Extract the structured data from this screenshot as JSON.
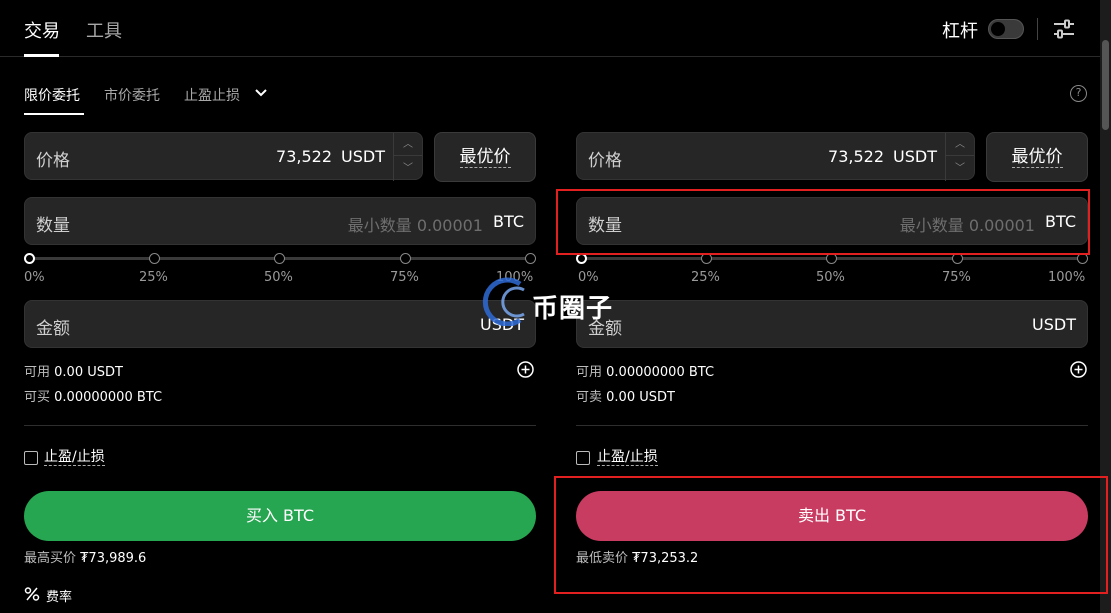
{
  "header": {
    "tabs": [
      {
        "label": "交易",
        "active": true
      },
      {
        "label": "工具",
        "active": false
      }
    ],
    "leverage_label": "杠杆",
    "leverage_enabled": false
  },
  "order_types": {
    "tabs": [
      "限价委托",
      "市价委托",
      "止盈止损"
    ],
    "active_index": 0
  },
  "buy": {
    "price_label": "价格",
    "price_value": "73,522",
    "price_unit": "USDT",
    "best_price_label": "最优价",
    "quantity_label": "数量",
    "quantity_placeholder": "最小数量 0.00001",
    "quantity_unit": "BTC",
    "slider_marks": [
      "0%",
      "25%",
      "50%",
      "75%",
      "100%"
    ],
    "amount_label": "金额",
    "amount_unit": "USDT",
    "available_label": "可用",
    "available_value": "0.00 USDT",
    "can_trade_label": "可买",
    "can_trade_value": "0.00000000 BTC",
    "tpsl_label": "止盈/止损",
    "button_label": "买入 BTC",
    "note_label": "最高买价",
    "note_value": "₮73,989.6",
    "accent_color": "#27a651"
  },
  "sell": {
    "price_label": "价格",
    "price_value": "73,522",
    "price_unit": "USDT",
    "best_price_label": "最优价",
    "quantity_label": "数量",
    "quantity_placeholder": "最小数量 0.00001",
    "quantity_unit": "BTC",
    "slider_marks": [
      "0%",
      "25%",
      "50%",
      "75%",
      "100%"
    ],
    "amount_label": "金额",
    "amount_unit": "USDT",
    "available_label": "可用",
    "available_value": "0.00000000 BTC",
    "can_trade_label": "可卖",
    "can_trade_value": "0.00 USDT",
    "tpsl_label": "止盈/止损",
    "button_label": "卖出 BTC",
    "note_label": "最低卖价",
    "note_value": "₮73,253.2",
    "accent_color": "#c93c62"
  },
  "fee_label": "费率",
  "watermark_text": "币圈子",
  "icons": [
    "settings-icon",
    "chevron-down-icon",
    "help-icon",
    "plus-circle-icon",
    "percent-icon",
    "arrow-up-icon",
    "arrow-down-icon"
  ]
}
